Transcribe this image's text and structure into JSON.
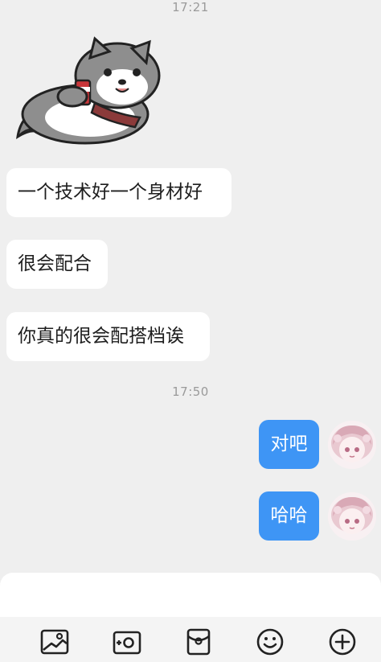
{
  "timestamps": [
    "17:21",
    "17:50"
  ],
  "messages_received": [
    {
      "text": "一个技术好一个身材好"
    },
    {
      "text": "很会配合"
    },
    {
      "text": "你真的很会配搭档诶"
    }
  ],
  "messages_sent": [
    {
      "text": "对吧"
    },
    {
      "text": "哈哈"
    }
  ],
  "sticker": {
    "icon": "raccoon-dog-drinking-sticker"
  },
  "toolbar": {
    "icons": [
      "image-icon",
      "camera-icon",
      "red-packet-icon",
      "emoji-icon",
      "plus-icon"
    ]
  },
  "colors": {
    "background": "#efefef",
    "sent_bubble": "#3e95f5",
    "received_bubble": "#ffffff"
  }
}
